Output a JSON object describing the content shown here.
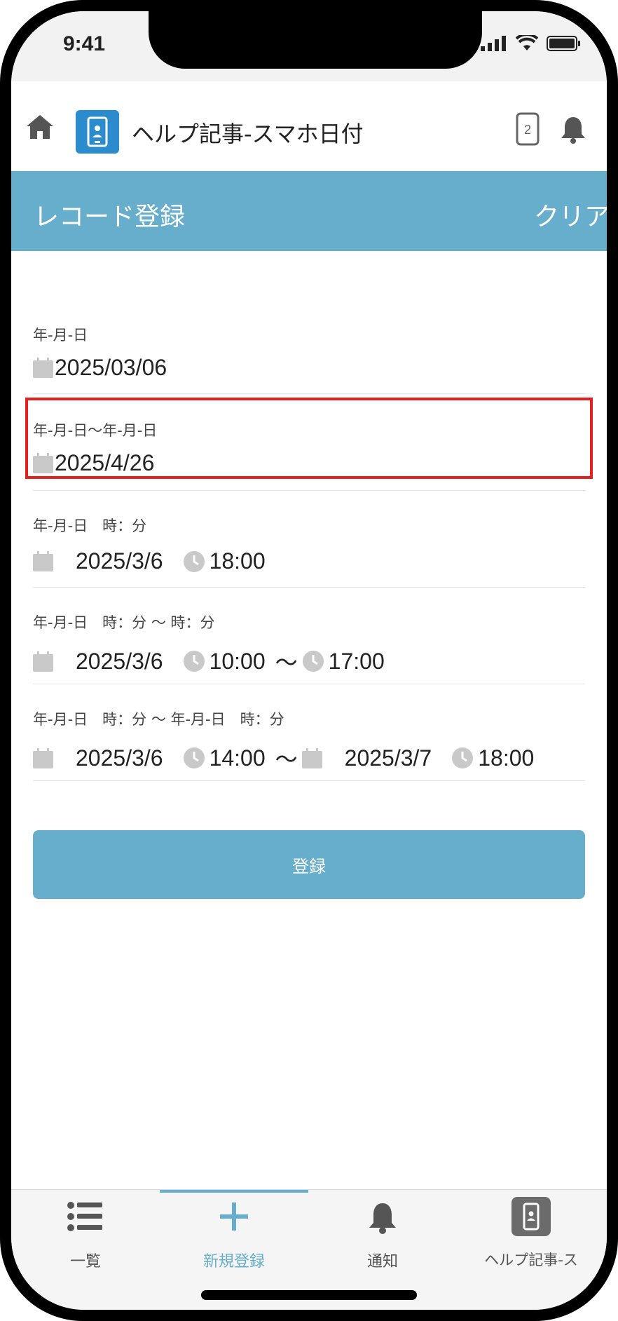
{
  "status_bar": {
    "time": "9:41"
  },
  "app": {
    "title": "ヘルプ記事-スマホ日付",
    "device_badge": "2"
  },
  "header": {
    "title": "レコード登録",
    "clear_label": "クリア"
  },
  "fields": [
    {
      "label": "年-月-日",
      "date": "2025/03/06"
    },
    {
      "label": "年-月-日〜年-月-日",
      "date": "2025/4/26"
    },
    {
      "label": "年-月-日　時：分",
      "date": "2025/3/6",
      "time": "18:00"
    },
    {
      "label": "年-月-日　時：分 〜 時：分",
      "date": "2025/3/6",
      "time_start": "10:00",
      "tilde": "〜",
      "time_end": "17:00"
    },
    {
      "label": "年-月-日　時：分 〜 年-月-日　時：分",
      "date_start": "2025/3/6",
      "time_start": "14:00",
      "tilde": "〜",
      "date_end": "2025/3/7",
      "time_end": "18:00"
    }
  ],
  "register_label": "登録",
  "tabs": [
    {
      "label": "一覧",
      "icon": "list-icon"
    },
    {
      "label": "新規登録",
      "icon": "plus-icon",
      "active": true
    },
    {
      "label": "通知",
      "icon": "bell-icon"
    },
    {
      "label": "ヘルプ記事-ス",
      "icon": "app-icon"
    }
  ],
  "colors": {
    "accent": "#66aecc",
    "highlight": "#e52020",
    "logo": "#2a8ccc"
  }
}
